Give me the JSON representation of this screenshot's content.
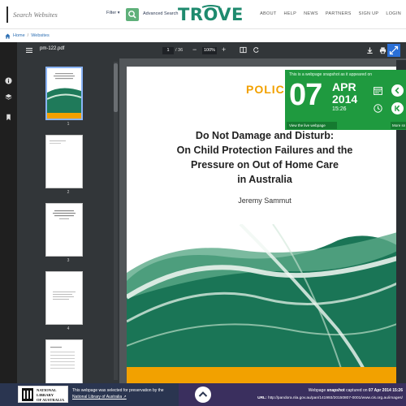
{
  "header": {
    "search_placeholder": "Search Websites",
    "filter_label": "Filter ▾",
    "advanced_search_label": "Advanced Search",
    "logo_text": "TROVE",
    "nav": [
      "ABOUT",
      "HELP",
      "NEWS",
      "PARTNERS",
      "SIGN UP",
      "LOGIN"
    ]
  },
  "breadcrumb": {
    "home": "Home",
    "separator": "/",
    "current": "Websites"
  },
  "viewer": {
    "file_name": "pm-122.pdf",
    "current_page": "1",
    "total_pages": "/ 36",
    "zoom": "100%",
    "minus": "−",
    "plus": "+",
    "thumb_numbers": [
      "1",
      "2",
      "3",
      "4"
    ]
  },
  "page": {
    "heading": "POLICY",
    "title_lines": [
      "Do Not Damage and Disturb:",
      "On Child Protection Failures and the",
      "Pressure on Out of Home Care",
      "in Australia"
    ],
    "author": "Jeremy Sammut"
  },
  "snapshot": {
    "caption": "This is a webpage snapshot as it appeared on",
    "day": "07",
    "month": "APR",
    "year": "2014",
    "time": "15:26",
    "live_link": "View the live webpage",
    "more_link": "More sn"
  },
  "footer": {
    "nla_lines": [
      "NATIONAL",
      "LIBRARY",
      "OF AUSTRALIA"
    ],
    "selected_text": "This webpage was selected for preservation by the",
    "nla_link": "National Library of Australia ↗",
    "capture_prefix": "Webpage ",
    "capture_bold": "snapshot",
    "capture_mid": " captured on ",
    "capture_date": "07 Apr 2014 15:26",
    "url_label": "URL:",
    "url_value": "http://pandora.nla.gov.au/pan/141993/20150807-0001/www.cis.org.au/images/"
  },
  "colors": {
    "trove_green": "#1e8a6e",
    "snapshot_green": "#1f9a3f",
    "accent_orange": "#f2a100",
    "footer_navy": "#2a3550",
    "footer_purple": "#3a2f5e"
  }
}
